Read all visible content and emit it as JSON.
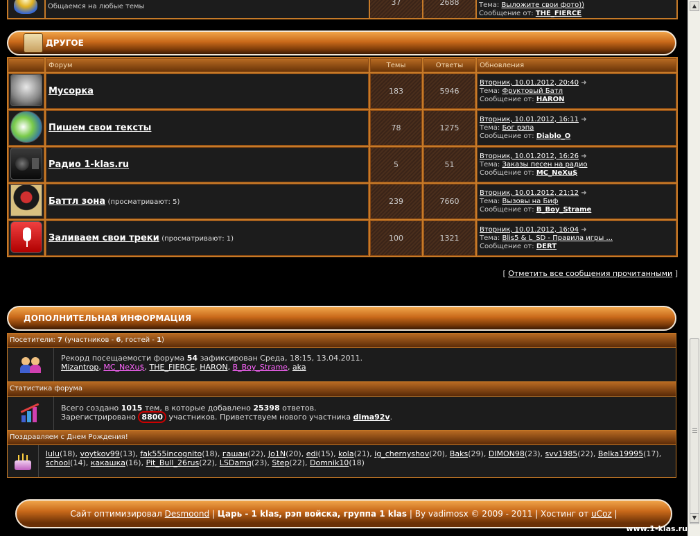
{
  "top_row": {
    "desc": "Общаемся на любые темы",
    "topics": "37",
    "replies": "2688",
    "update_topic_label": "Тема: ",
    "update_topic": "Выложите свои фото))",
    "update_author_label": "Сообщение от: ",
    "update_author": "THE_FIERCE"
  },
  "category": {
    "title": "ДРУГОЕ",
    "col_forum": "Форум",
    "col_topics": "Темы",
    "col_replies": "Ответы",
    "col_updates": "Обновления"
  },
  "forums": [
    {
      "name": "Мусорка",
      "watching": "",
      "topics": "183",
      "replies": "5946",
      "date": "Вторник, 10.01.2012, 20:40",
      "topic_label": "Тема: ",
      "topic": "Фруктовый Батл",
      "author_label": "Сообщение от: ",
      "author": "HARON"
    },
    {
      "name": "Пишем свои тексты",
      "watching": "",
      "topics": "78",
      "replies": "1275",
      "date": "Вторник, 10.01.2012, 16:11",
      "topic_label": "Тема: ",
      "topic": "Бог рэпа",
      "author_label": "Сообщение от: ",
      "author": "Diablo_O"
    },
    {
      "name": "Радио 1-klas.ru",
      "watching": "",
      "topics": "5",
      "replies": "51",
      "date": "Вторник, 10.01.2012, 16:26",
      "topic_label": "Тема: ",
      "topic": "Заказы песен на радио",
      "author_label": "Сообщение от: ",
      "author": "MC_NeXu$"
    },
    {
      "name": "Баттл зона",
      "watching": "(просматривают: 5)",
      "topics": "239",
      "replies": "7660",
      "date": "Вторник, 10.01.2012, 21:12",
      "topic_label": "Тема: ",
      "topic": "Вызовы на Биф",
      "author_label": "Сообщение от: ",
      "author": "B_Boy_Strame"
    },
    {
      "name": "Заливаем свои треки",
      "watching": "(просматривают: 1)",
      "topics": "100",
      "replies": "1321",
      "date": "Вторник, 10.01.2012, 16:04",
      "topic_label": "Тема: ",
      "topic": "Blis5 & L_SD - Правила игры ...",
      "author_label": "Сообщение от: ",
      "author": "DERT"
    }
  ],
  "mark_read": {
    "open": "[ ",
    "label": "Отметить все сообщения прочитанными",
    "close": " ]"
  },
  "info": {
    "title": "ДОПОЛНИТЕЛЬНАЯ ИНФОРМАЦИЯ",
    "visitors_prefix": "Посетители: ",
    "visitors_count": "7",
    "visitors_rest": "  (участников - ",
    "members_count": "6",
    "visitors_mid": ", гостей - ",
    "guests_count": "1",
    "visitors_end": ")",
    "record_a": "Рекорд посещаемости форума ",
    "record_num": "54",
    "record_b": " зафиксирован Среда, 18:15, 13.04.2011.",
    "online_users": [
      {
        "name": "Mizantrop",
        "color": "#ffffff"
      },
      {
        "name": "MC_NeXu$",
        "color": "#ff66ff"
      },
      {
        "name": "THE_FIERCE",
        "color": "#ffffff"
      },
      {
        "name": "HARON",
        "color": "#ffffff"
      },
      {
        "name": "B_Boy_Strame",
        "color": "#ff66ff"
      },
      {
        "name": "aka",
        "color": "#ffffff"
      }
    ],
    "stats_title": "Статистика форума",
    "stats_a": "Всего создано ",
    "stats_topics": "1015",
    "stats_b": " тем, в которые добавлено ",
    "stats_replies": "25398",
    "stats_c": " ответов.",
    "reg_a": "Зарегистрировано ",
    "reg_num": "8800",
    "reg_b": " участников. Приветствуем нового участника ",
    "new_member": "dima92v",
    "reg_c": ".",
    "bday_title": "Поздравляем с Днем Рождения!",
    "birthdays": [
      {
        "name": "lulu",
        "age": "(18)"
      },
      {
        "name": "voytkov99",
        "age": "(13)"
      },
      {
        "name": "fak555incognito",
        "age": "(18)"
      },
      {
        "name": "гашан",
        "age": "(22)"
      },
      {
        "name": "Jo1N",
        "age": "(20)"
      },
      {
        "name": "edi",
        "age": "(15)"
      },
      {
        "name": "kola",
        "age": "(21)"
      },
      {
        "name": "ig_chernyshov",
        "age": "(20)"
      },
      {
        "name": "Baks",
        "age": "(29)"
      },
      {
        "name": "DIMON98",
        "age": "(23)"
      },
      {
        "name": "svv1985",
        "age": "(22)"
      },
      {
        "name": "Belka19995",
        "age": "(17)"
      },
      {
        "name": "school",
        "age": "(14)"
      },
      {
        "name": "какашка",
        "age": "(16)"
      },
      {
        "name": "Pit_Bull_26rus",
        "age": "(22)"
      },
      {
        "name": "LSDamq",
        "age": "(23)"
      },
      {
        "name": "Step",
        "age": "(22)"
      },
      {
        "name": "Domnik10",
        "age": "(18)"
      }
    ]
  },
  "footer": {
    "a": "Сайт оптимизировал ",
    "link1": "Desmoond",
    "b": " | ",
    "bold": "Царь - 1 klas, рэп войска, группа 1 klas",
    "c": " | By vadimosx © 2009 - 2011 | Хостинг от ",
    "link2": "uCoz",
    "d": " |"
  },
  "brand": "www.1-klas.ru",
  "colors": {
    "accent": "#c67a28",
    "bg": "#000000",
    "cell": "#1c1c1c",
    "highlight": "#cc0000"
  }
}
